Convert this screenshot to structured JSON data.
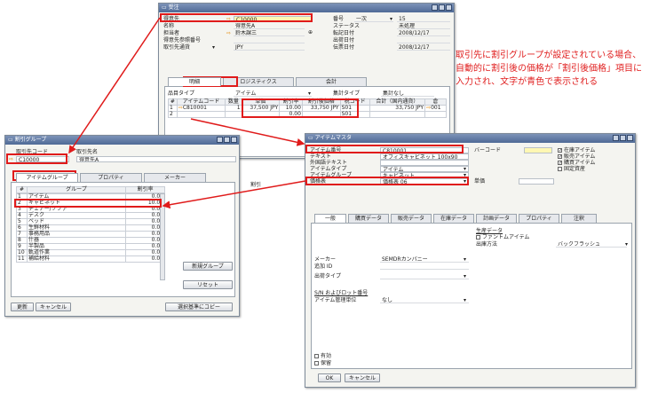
{
  "sales": {
    "title": "受注",
    "labels": [
      "得意先",
      "名称",
      "担当者",
      "得意先参照番号",
      "取引先通貨"
    ],
    "values": [
      "C10000",
      "得意先A",
      "鈴木課三",
      "",
      "JPY"
    ],
    "currency_type": "取引先通貨",
    "right_labels": [
      "番号",
      "ステータス",
      "転記日付",
      "出荷日付",
      "伝票日付"
    ],
    "series": "一次",
    "right_values": [
      "15",
      "未処理",
      "2008/12/17",
      "",
      "2008/12/17"
    ],
    "tabs": [
      "明細",
      "ロジスティクス",
      "会計"
    ],
    "item_type_label": "品目タイプ",
    "item_type_value": "アイテム",
    "summary_label": "集計タイプ",
    "summary_value": "集計なし",
    "cols": [
      "#",
      "アイテムコード",
      "数量",
      "単価",
      "割引率",
      "割引後価格",
      "税コード",
      "合計（国内通貨）",
      "倉"
    ],
    "rows": [
      [
        "1",
        "C810001",
        "1",
        "37,500 JPY",
        "10.00",
        "33,750 JPY",
        "S01",
        "33,750 JPY",
        "001"
      ],
      [
        "2",
        "",
        "",
        "",
        "0.00",
        "",
        "S01",
        "",
        ""
      ]
    ]
  },
  "annotation": "取引先に割引グループが設定されている場合、自動的に割引後の価格が「割引後価格」項目に入力され、文字が青色で表示される",
  "discount": {
    "title": "割引グループ",
    "code_label": "取引先コード",
    "name_label": "取引先名",
    "code": "C10000",
    "name": "得意先A",
    "tabs": [
      "アイテムグループ",
      "プロパティ",
      "メーカー"
    ],
    "cols": [
      "#",
      "グループ",
      "割引率"
    ],
    "rows": [
      [
        "1",
        "アイテム",
        "0.00"
      ],
      [
        "2",
        "キャビネット",
        "10.00"
      ],
      [
        "3",
        "チェアー/ソファ",
        "0.00"
      ],
      [
        "4",
        "デスク",
        "0.00"
      ],
      [
        "5",
        "ベッド",
        "0.00"
      ],
      [
        "6",
        "生鮮材料",
        "0.00"
      ],
      [
        "7",
        "事務用品",
        "0.00"
      ],
      [
        "8",
        "什器",
        "0.00"
      ],
      [
        "9",
        "半製品",
        "0.00"
      ],
      [
        "10",
        "軌道作業",
        "0.00"
      ],
      [
        "11",
        "補給材料",
        "0.00"
      ]
    ],
    "btn_new_group": "新規グループ",
    "btn_reset": "リセット",
    "btn_update": "更新",
    "btn_cancel": "キャンセル",
    "btn_copy": "選択基準にコピー",
    "right_label": "割引"
  },
  "item": {
    "title": "アイテムマスタ",
    "labels": [
      "アイテム番号",
      "テキスト",
      "外国語テキスト",
      "アイテムタイプ",
      "アイテムグループ",
      "価格表"
    ],
    "values": [
      "C810001",
      "オフィスキャビネット 100x90",
      "",
      "アイテム",
      "キャビネット",
      "価格表 06"
    ],
    "barcode_label": "バーコード",
    "price_label": "単価",
    "checks": [
      "在庫アイテム",
      "販売アイテム",
      "購買アイテム",
      "固定資産"
    ],
    "tabs": [
      "一般",
      "購買データ",
      "販売データ",
      "在庫データ",
      "計画データ",
      "プロパティ",
      "注釈"
    ],
    "mfr_label": "メーカー",
    "mfr_value": "SEMDRカンパニー",
    "addid_label": "追加 ID",
    "shipping_label": "出荷タイプ",
    "serial_label": "S/N およびロット番号",
    "manage_label": "アイテム管理単位",
    "manage_value": "なし",
    "tax_label": "生産データ",
    "phantom_label": "ファントムアイテム",
    "issue_label": "出庫方法",
    "issue_value": "バックフラッシュ",
    "active_label": "有効",
    "hold_label": "保留",
    "btn_ok": "OK",
    "btn_cancel": "キャンセル"
  }
}
